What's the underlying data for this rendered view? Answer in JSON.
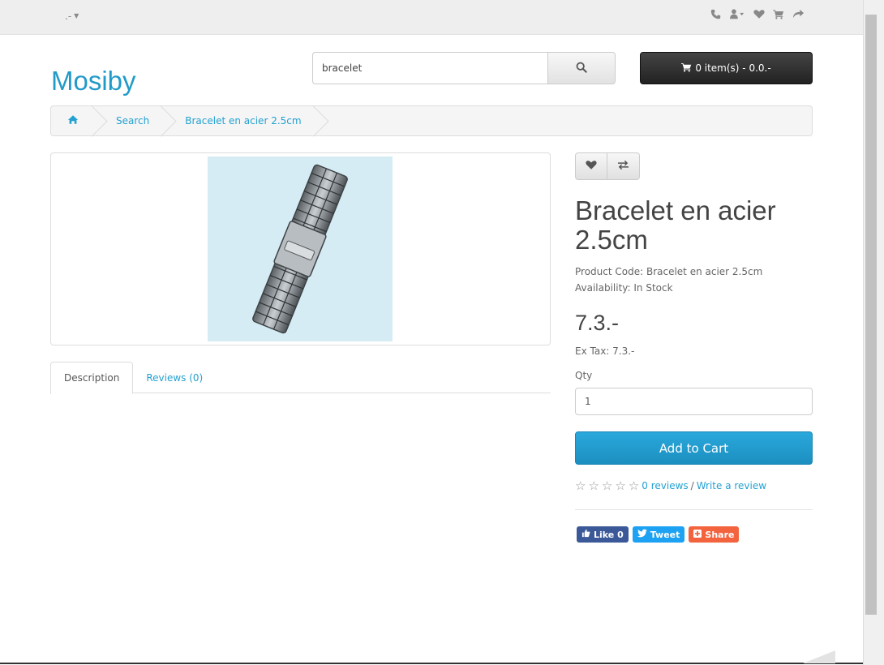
{
  "topbar": {
    "currency_label": ".-",
    "icons": [
      "phone-icon",
      "user-icon",
      "heart-icon",
      "cart-icon",
      "share-icon"
    ]
  },
  "header": {
    "logo": "Mosiby",
    "search": {
      "value": "bracelet",
      "placeholder": "Search"
    },
    "cart_label": "0 item(s) - 0.0.-"
  },
  "breadcrumb": {
    "items": [
      "Search",
      "Bracelet en acier 2.5cm"
    ]
  },
  "tabs": [
    {
      "label": "Description",
      "active": true
    },
    {
      "label": "Reviews (0)",
      "active": false
    }
  ],
  "product": {
    "title": "Bracelet en acier 2.5cm",
    "code_line": "Product Code: Bracelet en acier 2.5cm",
    "availability_line": "Availability: In Stock",
    "price": "7.3.-",
    "ex_tax": "Ex Tax: 7.3.-",
    "qty_label": "Qty",
    "qty_value": "1",
    "add_to_cart": "Add to Cart",
    "rating_stars": 0,
    "reviews_link": "0 reviews",
    "rating_sep": "/",
    "write_review": "Write a review"
  },
  "social": {
    "like": "Like 0",
    "tweet": "Tweet",
    "share": "Share"
  },
  "colors": {
    "accent": "#229ac8",
    "cart_button": "#222222",
    "add_to_cart": "#2aa8dc",
    "facebook": "#3b5998",
    "twitter": "#1da1f2",
    "share": "#f2633e"
  }
}
